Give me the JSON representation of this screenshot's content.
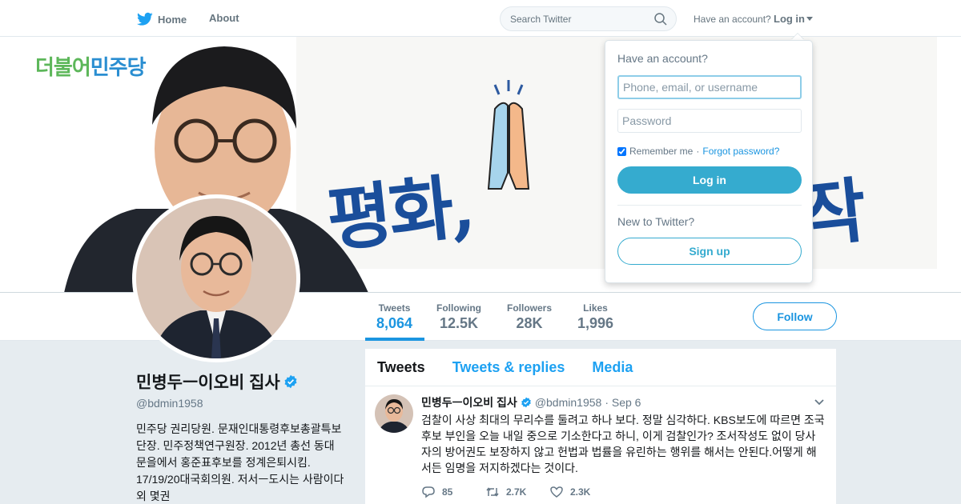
{
  "nav": {
    "home_label": "Home",
    "about_label": "About",
    "home_icon": "twitter-bird-icon",
    "search_placeholder": "Search Twitter",
    "search_icon": "search-icon",
    "have_account": "Have an account?",
    "login_label": "Log in",
    "accent_color": "#1da1f2"
  },
  "banner": {
    "party_logo_part1": "더불어",
    "party_logo_part2": "민주당",
    "slogan_left": "평화,",
    "slogan_right": "작",
    "slogan_color": "#1a4e9b"
  },
  "stats": [
    {
      "label": "Tweets",
      "value": "8,064"
    },
    {
      "label": "Following",
      "value": "12.5K"
    },
    {
      "label": "Followers",
      "value": "28K"
    },
    {
      "label": "Likes",
      "value": "1,996"
    }
  ],
  "follow_label": "Follow",
  "profile": {
    "name": "민병두ㅡ이오비 집사",
    "handle": "@bdmin1958",
    "bio": "민주당 권리당원. 문재인대통령후보총괄특보단장. 민주정책연구원장. 2012년 총선 동대문을에서 홍준표후보를 정계은퇴시킴. 17/19/20대국회의원. 저서ㅡ도시는 사람이다 외 몇권"
  },
  "timeline": {
    "tabs": [
      "Tweets",
      "Tweets & replies",
      "Media"
    ],
    "tweet": {
      "name": "민병두ㅡ이오비 집사",
      "handle": "@bdmin1958",
      "date": "· Sep 6",
      "text": "검찰이 사상 최대의 무리수를 둘려고 하나 보다. 정말 심각하다. KBS보도에 따르면 조국 후보 부인을 오늘 내일 중으로 기소한다고 하니, 이게 검찰인가? 조서작성도 없이 당사자의 방어권도 보장하지 않고 헌법과 법률을 유린하는 행위를 해서는 안된다.어떻게 해서든 임명을 저지하겠다는 것이다.",
      "replies": "85",
      "retweets": "2.7K",
      "likes": "2.3K"
    }
  },
  "login_dropdown": {
    "title": "Have an account?",
    "username_placeholder": "Phone, email, or username",
    "password_placeholder": "Password",
    "remember_label": "Remember me",
    "forgot_label": "Forgot password?",
    "login_button": "Log in",
    "new_label": "New to Twitter?",
    "signup_button": "Sign up",
    "button_color": "#35abcf"
  }
}
